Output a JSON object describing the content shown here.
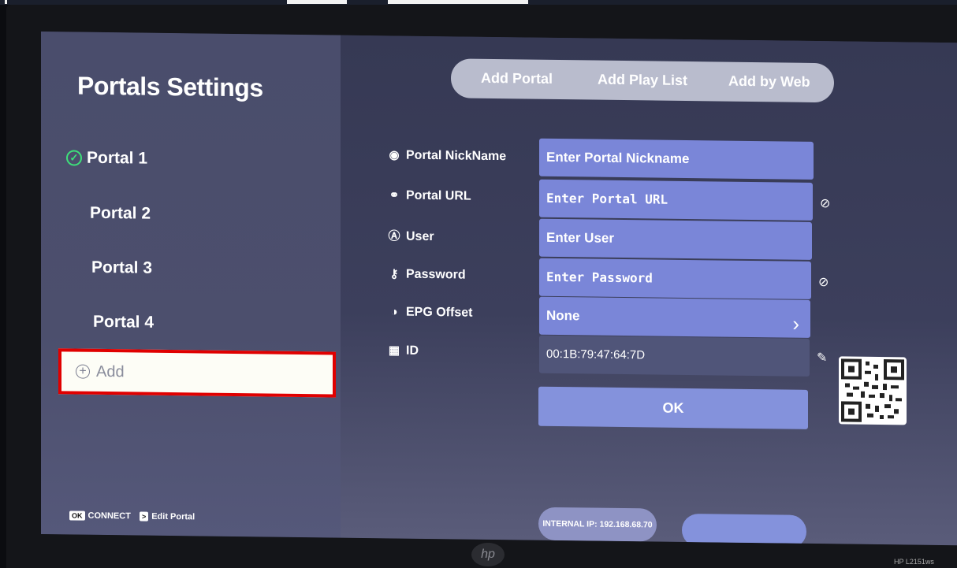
{
  "sidebar": {
    "title": "Portals Settings",
    "portals": [
      "Portal 1",
      "Portal 2",
      "Portal 3",
      "Portal 4"
    ],
    "add_label": "Add",
    "hint_ok_key": "OK",
    "hint_ok_text": "CONNECT",
    "hint_edit_key": ">",
    "hint_edit_text": "Edit Portal"
  },
  "tabs": [
    "Add Portal",
    "Add Play List",
    "Add by Web"
  ],
  "form": {
    "nickname_label": "Portal NickName",
    "nickname_value": "Enter Portal Nickname",
    "url_label": "Portal URL",
    "url_value": "Enter Portal URL",
    "user_label": "User",
    "user_value": "Enter User",
    "password_label": "Password",
    "password_value": "Enter Password",
    "epg_label": "EPG Offset",
    "epg_value": "None",
    "id_label": "ID",
    "id_value": "00:1B:79:47:64:7D",
    "ok_label": "OK"
  },
  "footer": {
    "internal_ip": "INTERNAL IP: 192.168.68.70"
  },
  "monitor": {
    "brand": "hp",
    "model": "HP L2151ws"
  },
  "colors": {
    "field_bg": "#7a86d8",
    "selected_check": "#3ee07a",
    "add_highlight_border": "#e00000"
  },
  "icons": {
    "selected": "check-circle-icon",
    "add": "plus-circle-icon",
    "nickname": "user-circle-icon",
    "url": "link-icon",
    "user": "account-circle-icon",
    "password": "key-icon",
    "epg": "clock-half-icon",
    "id": "qr-code-icon",
    "visibility": "eye-off-icon",
    "edit": "edit-icon",
    "next": "chevron-right-icon"
  }
}
